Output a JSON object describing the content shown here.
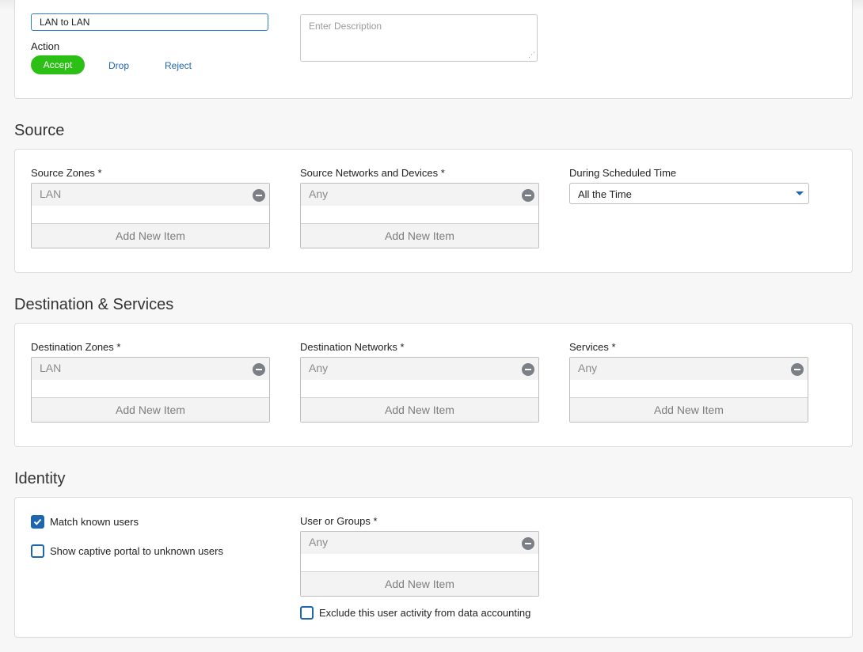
{
  "rule": {
    "name_value": "LAN to LAN",
    "action_label": "Action",
    "actions": {
      "accept": "Accept",
      "drop": "Drop",
      "reject": "Reject"
    },
    "description_placeholder": "Enter Description"
  },
  "source": {
    "title": "Source",
    "zones_label": "Source Zones *",
    "zones_item": "LAN",
    "networks_label": "Source Networks and Devices *",
    "networks_item": "Any",
    "schedule_label": "During Scheduled Time",
    "schedule_value": "All the Time"
  },
  "destination": {
    "title": "Destination & Services",
    "zones_label": "Destination Zones *",
    "zones_item": "LAN",
    "networks_label": "Destination Networks *",
    "networks_item": "Any",
    "services_label": "Services *",
    "services_item": "Any"
  },
  "identity": {
    "title": "Identity",
    "match_known_users": "Match known users",
    "captive_portal": "Show captive portal to unknown users",
    "users_label": "User or Groups *",
    "users_item": "Any",
    "exclude_label": "Exclude this user activity from data accounting"
  },
  "common": {
    "add_new_item": "Add New Item"
  }
}
